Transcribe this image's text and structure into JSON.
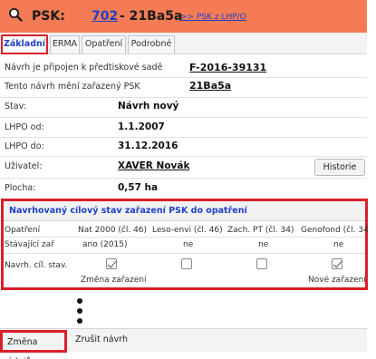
{
  "header": {
    "psk_label": "PSK:",
    "psk_number": "702",
    "psk_code": "- 21Ba5a",
    "psk_link": ">> PSK z LHP/O",
    "search_icon": "magnifier-icon",
    "bg_color": "#f47b55"
  },
  "tabs": [
    {
      "label": "Základní",
      "active": true
    },
    {
      "label": "ERMA",
      "active": false
    },
    {
      "label": "Opatření",
      "active": false
    },
    {
      "label": "Podrobné",
      "active": false
    }
  ],
  "info": {
    "predecessor_label": "Návrh je připojen k předtiskové sadě",
    "predecessor_value": "F-2016-39131",
    "changes_label": "Tento návrh mění zařazený PSK",
    "changes_value": "21Ba5a"
  },
  "fields": {
    "stav_label": "Stav:",
    "stav_value": "Návrh nový",
    "lhpo_od_label": "LHPO od:",
    "lhpo_od_value": "1.1.2007",
    "lhpo_do_label": "LHPO do:",
    "lhpo_do_value": "31.12.2016",
    "uzivatel_label": "Uživatel:",
    "uzivatel_value": "XAVER  Novák",
    "historie_button": "Historie",
    "plocha_label": "Plocha:",
    "plocha_value": "0,57 ha"
  },
  "target_section": {
    "title": "Navrhovaný cílový stav zařazení PSK do opatření",
    "columns": [
      "Opatření",
      "Nat 2000 (čl. 46)",
      "Leso-envi (čl. 46)",
      "Zach. PT (čl. 34)",
      "Genofond (čl. 34"
    ],
    "current_row_label": "Stávající zař",
    "current_values": [
      "ano (2015)",
      "ne",
      "ne",
      "ne"
    ],
    "proposed_row_label": "Navrh. cíl. stav.",
    "proposed_checked": [
      true,
      false,
      false,
      true
    ],
    "change_notes": [
      "Změna zařazení",
      "Nové zařazení"
    ]
  },
  "more_icon": "vertical-ellipsis-icon",
  "footer": {
    "change_button": "Změna údajů",
    "cancel_button": "Zrušit návrh"
  },
  "colors": {
    "accent_red": "#d91f2a",
    "link_blue": "#1f3fc7"
  }
}
